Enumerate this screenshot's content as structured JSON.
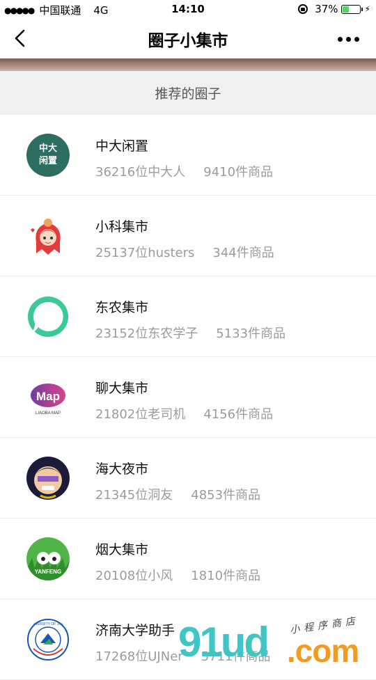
{
  "status": {
    "carrier": "中国联通",
    "network": "4G",
    "time": "14:10",
    "battery": "37%"
  },
  "nav": {
    "title": "圈子小集市"
  },
  "section": {
    "title": "推荐的圈子"
  },
  "circles": [
    {
      "name": "中大闲置",
      "members": "36216位中大人",
      "goods": "9410件商品",
      "avatar_text": "中大\n闲置"
    },
    {
      "name": "小科集市",
      "members": "25137位husters",
      "goods": "344件商品"
    },
    {
      "name": "东农集市",
      "members": "23152位东农学子",
      "goods": "5133件商品"
    },
    {
      "name": "聊大集市",
      "members": "21802位老司机",
      "goods": "4156件商品",
      "avatar_text": "Map",
      "avatar_subtext": "LIAOBA MAP"
    },
    {
      "name": "海大夜市",
      "members": "21345位洞友",
      "goods": "4853件商品"
    },
    {
      "name": "烟大集市",
      "members": "20108位小风",
      "goods": "1810件商品",
      "avatar_text": "YANFENG"
    },
    {
      "name": "济南大学助手",
      "members": "17268位UJNer",
      "goods": "5711件商品",
      "avatar_text": "UNIVERSITY OF JINAN"
    }
  ],
  "watermark": {
    "main": "91ud",
    "domain": ".com",
    "sub": "小程序商店"
  },
  "colors": {
    "accent_green": "#3fc5c3",
    "accent_orange": "#f39a22",
    "text_gray": "#9b9b9b"
  }
}
